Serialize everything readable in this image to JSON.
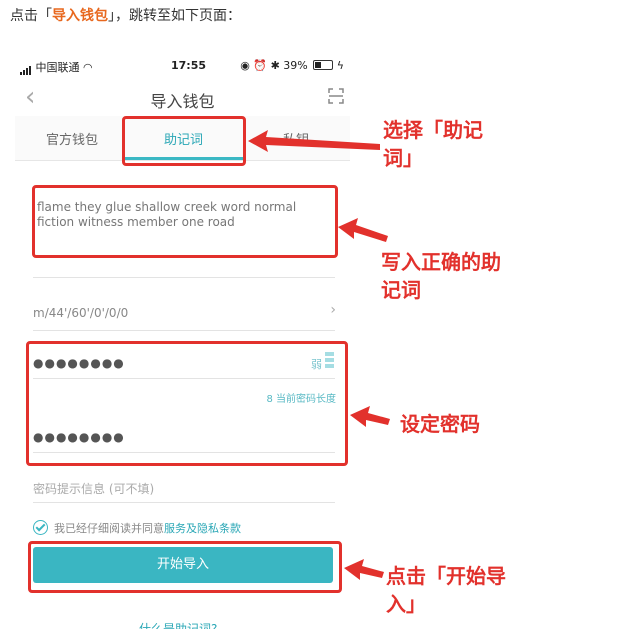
{
  "caption": {
    "prefix": "点击「",
    "highlight": "导入钱包",
    "suffix": "」，跳转至如下页面："
  },
  "statusbar": {
    "carrier": "中国联通",
    "time": "17:55",
    "battery": "39%"
  },
  "navbar": {
    "title": "导入钱包"
  },
  "tabs": [
    {
      "label": "官方钱包",
      "active": false
    },
    {
      "label": "助记词",
      "active": true
    },
    {
      "label": "私钥",
      "active": false
    }
  ],
  "mnemonic": {
    "value": "flame they glue shallow creek word normal fiction witness member one road"
  },
  "path": {
    "value": "m/44'/60'/0'/0/0"
  },
  "password": {
    "masked": "●●●●●●●●",
    "strength": "弱",
    "length_hint": "8 当前密码长度"
  },
  "repeat_password": {
    "masked": "●●●●●●●●"
  },
  "hint_field": {
    "placeholder": "密码提示信息 (可不填)"
  },
  "agree": {
    "text": "我已经仔细阅读并同意",
    "link": "服务及隐私条款"
  },
  "start_button": {
    "label": "开始导入"
  },
  "what_link": {
    "label": "什么是助记词?"
  },
  "annotations": {
    "tab": "选择「助记\n词」",
    "mnemonic": "写入正确的助\n记词",
    "password": "设定密码",
    "start": "点击「开始导\n入」"
  },
  "colors": {
    "accent": "#3ab6c2",
    "highlight": "#e2312c",
    "caption_highlight": "#e8681e"
  }
}
